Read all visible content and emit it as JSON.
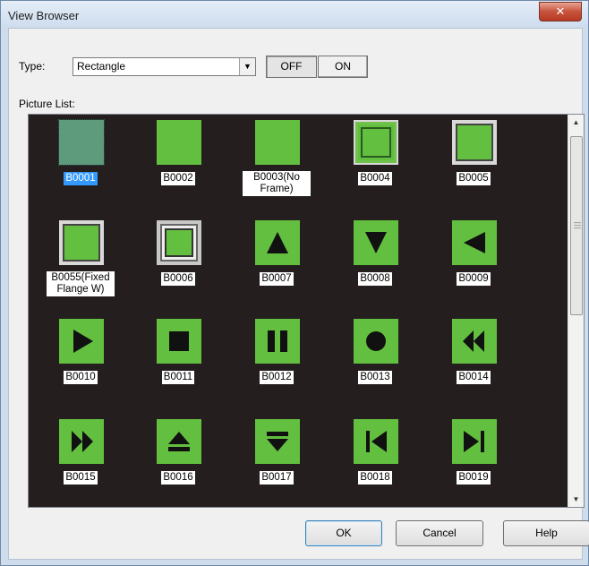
{
  "window": {
    "title": "View Browser",
    "close_glyph": "✕"
  },
  "type_label": "Type:",
  "type_select": {
    "value": "Rectangle",
    "arrow": "▼"
  },
  "toggle": {
    "off_label": "OFF",
    "on_label": "ON"
  },
  "picture_list_label": "Picture List:",
  "pictures": [
    {
      "caption": "B0001",
      "style": "selected",
      "selected": true
    },
    {
      "caption": "B0002",
      "style": "plain"
    },
    {
      "caption": "B0003(No Frame)",
      "style": "plain"
    },
    {
      "caption": "B0004",
      "style": "frame1"
    },
    {
      "caption": "B0005",
      "style": "frame2"
    },
    {
      "caption": "B0055(Fixed Flange W)",
      "style": "frame2"
    },
    {
      "caption": "B0006",
      "style": "frame3"
    },
    {
      "caption": "B0007",
      "style": "icon",
      "icon": "triangle-up-icon"
    },
    {
      "caption": "B0008",
      "style": "icon",
      "icon": "triangle-down-icon"
    },
    {
      "caption": "B0009",
      "style": "icon",
      "icon": "triangle-left-icon"
    },
    {
      "caption": "B0010",
      "style": "icon",
      "icon": "play-icon"
    },
    {
      "caption": "B0011",
      "style": "icon",
      "icon": "stop-icon"
    },
    {
      "caption": "B0012",
      "style": "icon",
      "icon": "pause-icon"
    },
    {
      "caption": "B0013",
      "style": "icon",
      "icon": "record-icon"
    },
    {
      "caption": "B0014",
      "style": "icon",
      "icon": "rewind-icon"
    },
    {
      "caption": "B0015",
      "style": "icon",
      "icon": "fast-forward-icon"
    },
    {
      "caption": "B0016",
      "style": "icon",
      "icon": "eject-icon"
    },
    {
      "caption": "B0017",
      "style": "icon",
      "icon": "insert-icon"
    },
    {
      "caption": "B0018",
      "style": "icon",
      "icon": "skip-back-icon"
    },
    {
      "caption": "B0019",
      "style": "icon",
      "icon": "skip-forward-icon"
    }
  ],
  "buttons": {
    "ok": "OK",
    "cancel": "Cancel",
    "help": "Help"
  },
  "colors": {
    "list_bg": "#241e1e",
    "picture_green": "#63bf3f",
    "selection": "#3399ff"
  }
}
